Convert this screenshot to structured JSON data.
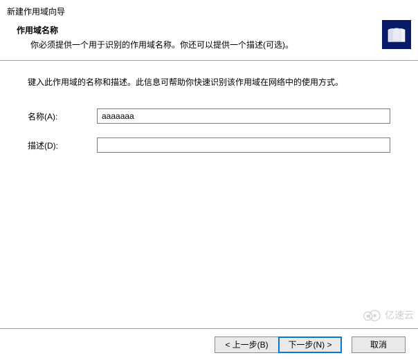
{
  "window": {
    "title": "新建作用域向导"
  },
  "header": {
    "title": "作用域名称",
    "subtitle": "你必须提供一个用于识别的作用域名称。你还可以提供一个描述(可选)。"
  },
  "content": {
    "instruction": "键入此作用域的名称和描述。此信息可帮助你快速识别该作用域在网络中的使用方式。",
    "fields": {
      "name": {
        "label": "名称(A):",
        "value": "aaaaaaa",
        "placeholder": ""
      },
      "desc": {
        "label": "描述(D):",
        "value": "",
        "placeholder": ""
      }
    }
  },
  "footer": {
    "back": "< 上一步(B)",
    "next": "下一步(N) >",
    "cancel": "取消"
  },
  "watermark": {
    "text": "亿速云"
  }
}
